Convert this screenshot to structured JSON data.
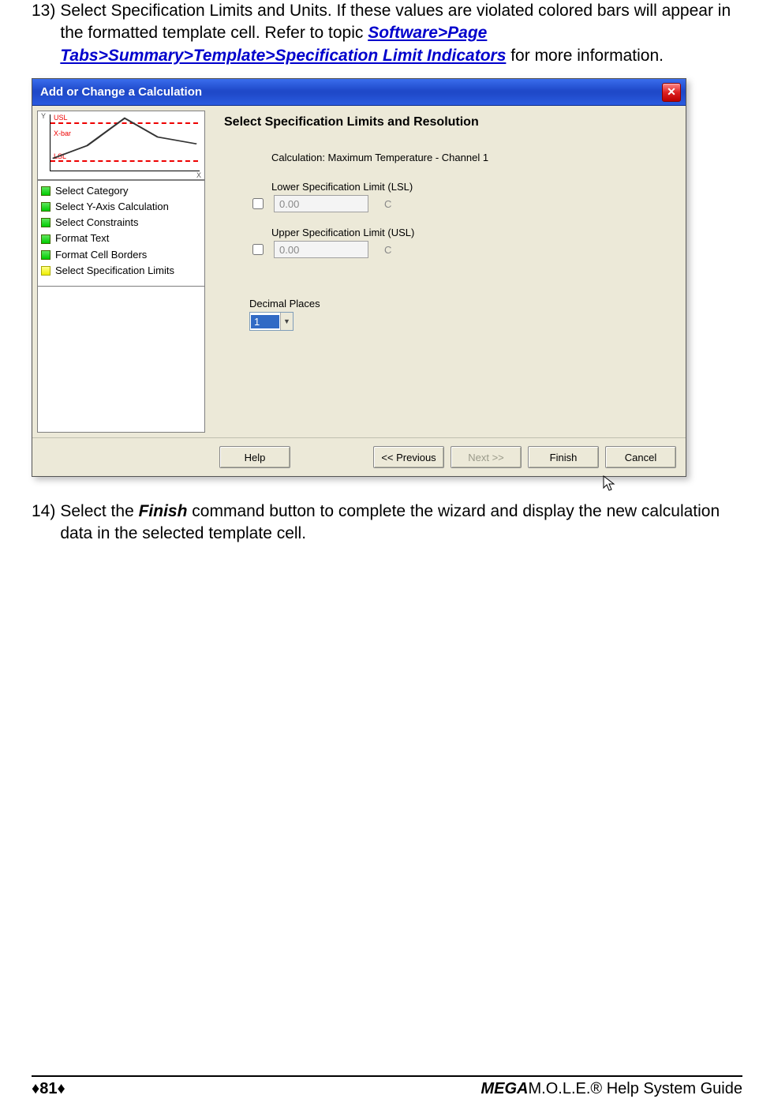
{
  "steps": {
    "s13_num": "13)",
    "s13_a": "Select Specification Limits and Units. If these values are violated colored bars will appear in the formatted template cell. Refer to  topic ",
    "s13_link": "Software>Page Tabs>Summary>Template>Specification Limit Indicators",
    "s13_b": " for more information.",
    "s14_num": "14)",
    "s14_a": "Select the ",
    "s14_bold": "Finish",
    "s14_b": " command button to complete the wizard and display the new calculation data in the selected template cell."
  },
  "dialog": {
    "title": "Add or Change a Calculation",
    "heading": "Select Specification Limits and Resolution",
    "calc_label": "Calculation: Maximum Temperature - Channel 1",
    "lsl_label": "Lower Specification Limit (LSL)",
    "usl_label": "Upper Specification Limit (USL)",
    "lsl_value": "0.00",
    "usl_value": "0.00",
    "unit": "C",
    "decimal_label": "Decimal Places",
    "decimal_value": "1",
    "chart": {
      "y": "Y",
      "x": "X",
      "usl": "USL",
      "lsl": "LSL",
      "xbar": "X-bar"
    },
    "wizard_steps": [
      "Select Category",
      "Select Y-Axis Calculation",
      "Select Constraints",
      "Format Text",
      "Format Cell Borders",
      "Select Specification Limits"
    ],
    "buttons": {
      "help": "Help",
      "prev": "<< Previous",
      "next": "Next >>",
      "finish": "Finish",
      "cancel": "Cancel"
    }
  },
  "footer": {
    "page": "♦81♦",
    "guide_prefix": "MEGA",
    "guide_rest": "M.O.L.E.® Help System Guide"
  }
}
